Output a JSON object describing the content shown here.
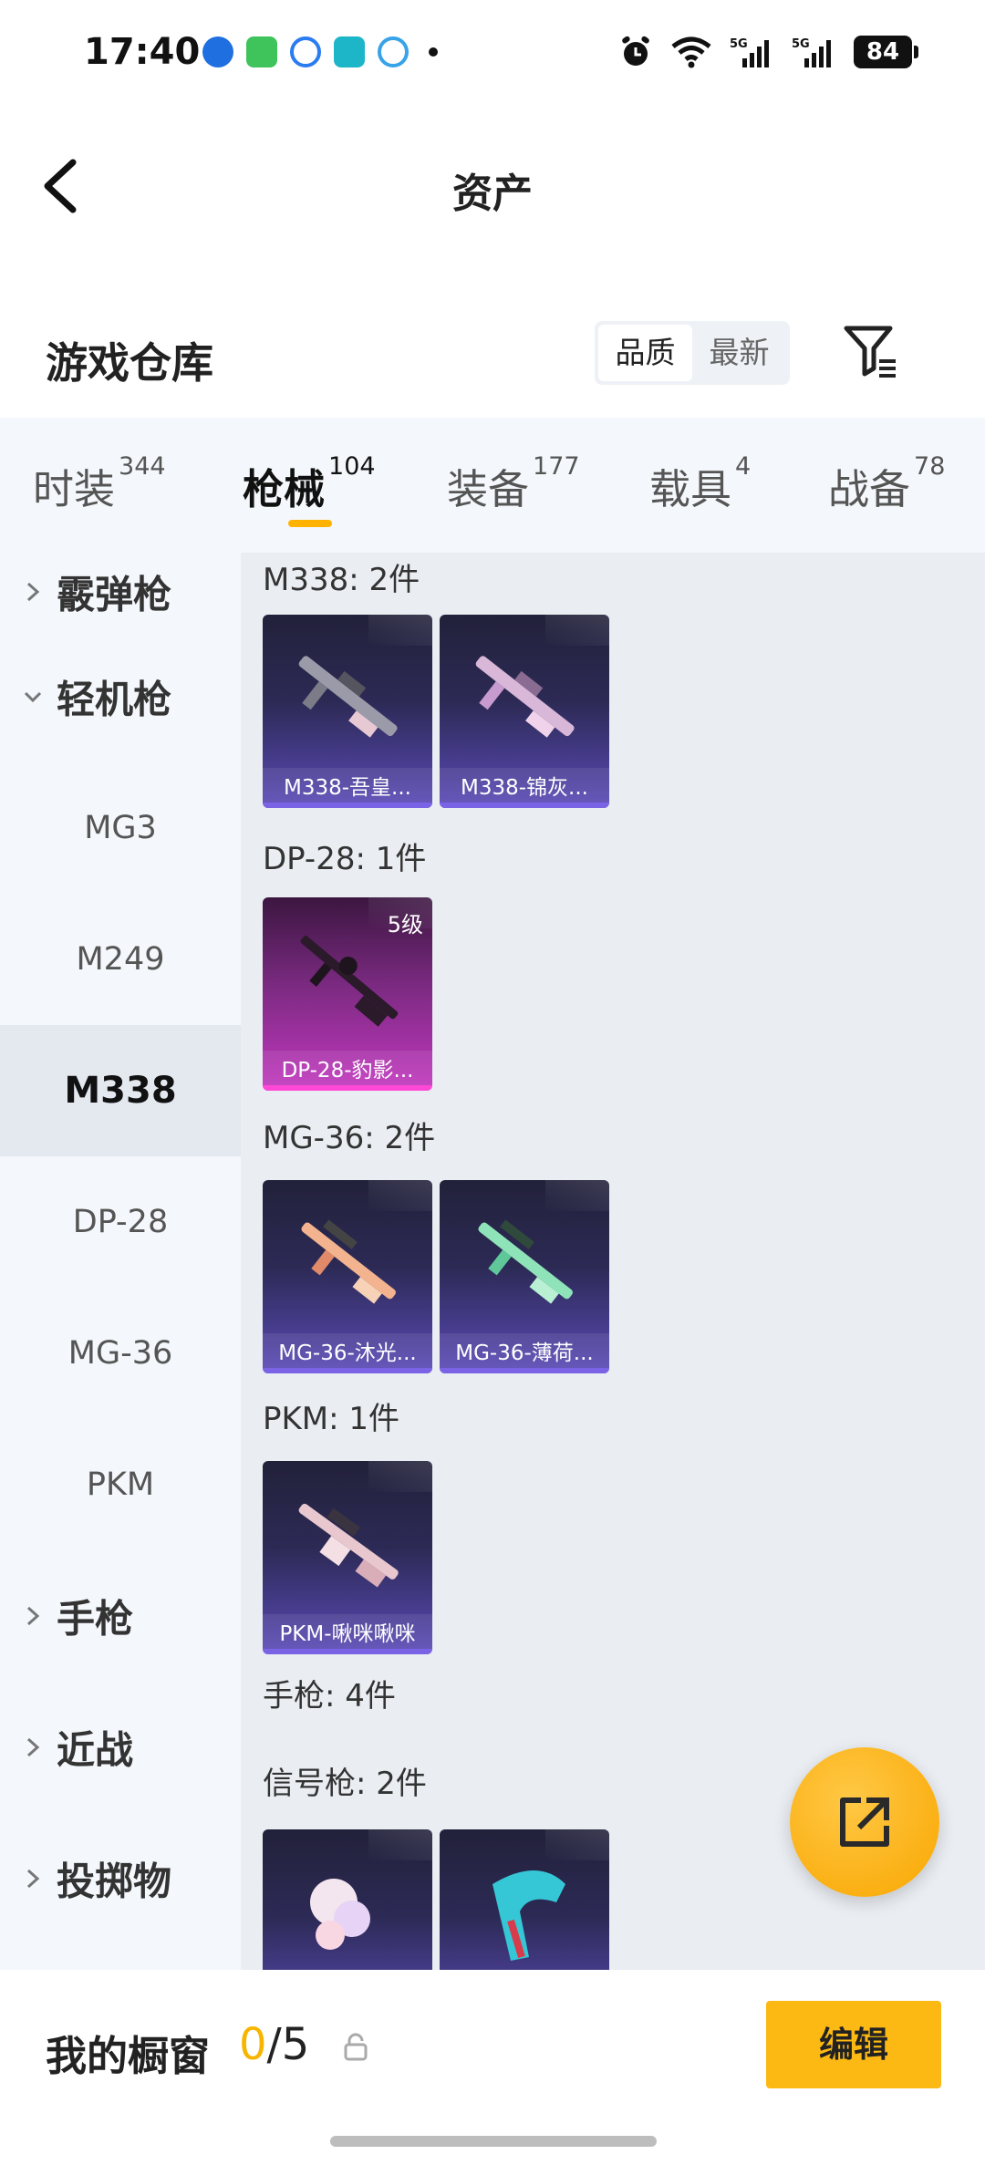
{
  "status_bar": {
    "time": "17:40",
    "battery": "84",
    "network": "5G"
  },
  "header": {
    "title": "资产"
  },
  "warehouse": {
    "title": "游戏仓库",
    "sort_options": [
      "品质",
      "最新"
    ],
    "active_sort": "品质"
  },
  "tabs": [
    {
      "label": "时装",
      "count": "344"
    },
    {
      "label": "枪械",
      "count": "104",
      "active": true
    },
    {
      "label": "装备",
      "count": "177"
    },
    {
      "label": "载具",
      "count": "4"
    },
    {
      "label": "战备",
      "count": "78"
    }
  ],
  "sidebar": {
    "items": [
      {
        "label": "霰弹枪",
        "type": "category",
        "expanded": false
      },
      {
        "label": "轻机枪",
        "type": "category",
        "expanded": true
      },
      {
        "label": "MG3",
        "type": "sub"
      },
      {
        "label": "M249",
        "type": "sub"
      },
      {
        "label": "M338",
        "type": "sub",
        "selected": true
      },
      {
        "label": "DP-28",
        "type": "sub"
      },
      {
        "label": "MG-36",
        "type": "sub"
      },
      {
        "label": "PKM",
        "type": "sub"
      },
      {
        "label": "手枪",
        "type": "category",
        "expanded": false
      },
      {
        "label": "近战",
        "type": "category",
        "expanded": false
      },
      {
        "label": "投掷物",
        "type": "category",
        "expanded": false
      }
    ]
  },
  "content": {
    "groups": [
      {
        "title": "M338: 2件",
        "items": [
          {
            "name": "M338-吾皇..."
          },
          {
            "name": "M338-锦灰..."
          }
        ]
      },
      {
        "title": "DP-28: 1件",
        "items": [
          {
            "name": "DP-28-豹影...",
            "level": "5级",
            "rarity": "purple"
          }
        ]
      },
      {
        "title": "MG-36: 2件",
        "items": [
          {
            "name": "MG-36-沐光..."
          },
          {
            "name": "MG-36-薄荷..."
          }
        ]
      },
      {
        "title": "PKM: 1件",
        "items": [
          {
            "name": "PKM-啾咪啾咪"
          }
        ]
      },
      {
        "title": "手枪: 4件",
        "items": []
      },
      {
        "title": "信号枪: 2件",
        "items": [
          {
            "name": ""
          },
          {
            "name": ""
          }
        ]
      }
    ]
  },
  "showcase": {
    "label": "我的橱窗",
    "current": "0",
    "total": "/5"
  },
  "edit_button": {
    "label": "编辑"
  },
  "colors": {
    "accent": "#f7b500",
    "fab": "#f9a600",
    "edit": "#fdb913"
  }
}
